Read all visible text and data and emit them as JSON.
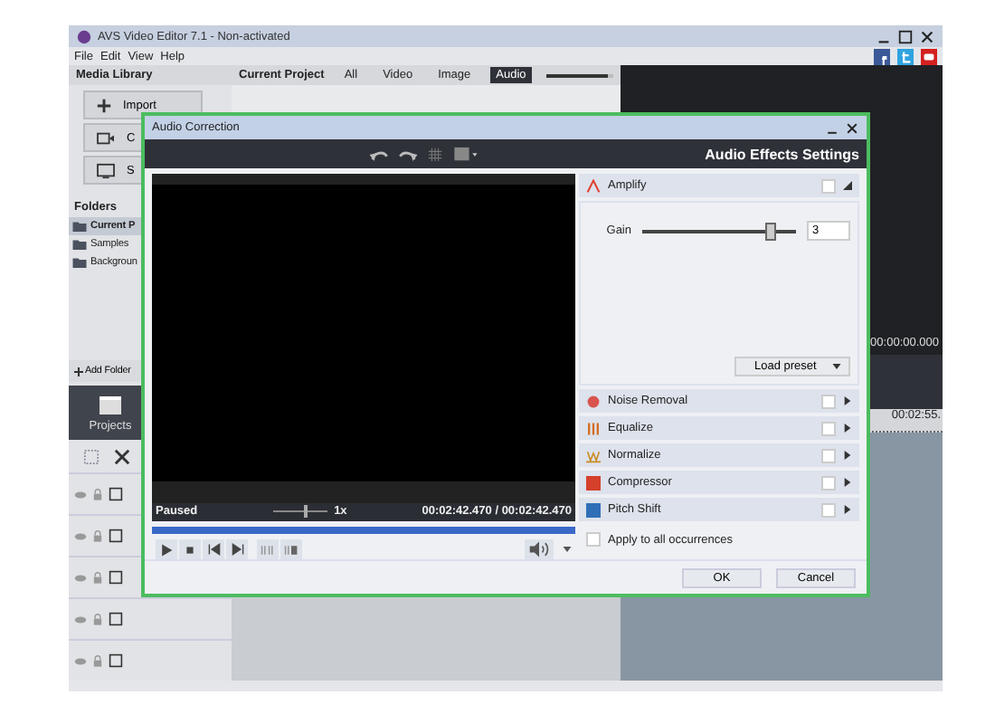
{
  "window": {
    "title": "AVS Video Editor 7.1 - Non-activated"
  },
  "menu": [
    "File",
    "Edit",
    "View",
    "Help"
  ],
  "media_library": {
    "title": "Media Library",
    "buttons": [
      "Import",
      "C",
      "S"
    ],
    "folders_title": "Folders",
    "folders": [
      {
        "label": "Current P",
        "selected": true
      },
      {
        "label": "Samples",
        "selected": false
      },
      {
        "label": "Backgroun",
        "selected": false
      }
    ],
    "add_folder": "Add Folder",
    "projects": "Projects"
  },
  "current_project": {
    "title": "Current Project",
    "tabs": [
      {
        "label": "All",
        "selected": false
      },
      {
        "label": "Video",
        "selected": false
      },
      {
        "label": "Image",
        "selected": false
      },
      {
        "label": "Audio",
        "selected": true
      }
    ],
    "zoom": {
      "level": 0.92
    }
  },
  "preview": {
    "time": "00:00:00.000",
    "ruler_time": "00:02:55."
  },
  "dialog": {
    "title": "Audio Correction",
    "panel_title": "Audio Effects Settings",
    "status": "Paused",
    "speed": {
      "level": 0.6
    },
    "speed_label": "1x",
    "time": "00:02:42.470 / 00:02:42.470",
    "progress": {
      "level": 1
    },
    "effects": [
      {
        "name": "Amplify",
        "kind": "amplify",
        "checked": false,
        "expanded": true,
        "gain_label": "Gain",
        "gain": {
          "level": 0.83
        },
        "gain_value": "3",
        "preset": "Load preset"
      },
      {
        "name": "Noise Removal",
        "kind": "noise",
        "checked": false,
        "expanded": false
      },
      {
        "name": "Equalize",
        "kind": "equalize",
        "checked": false,
        "expanded": false
      },
      {
        "name": "Normalize",
        "kind": "normalize",
        "checked": false,
        "expanded": false
      },
      {
        "name": "Compressor",
        "kind": "compressor",
        "checked": false,
        "expanded": false
      },
      {
        "name": "Pitch Shift",
        "kind": "pitch",
        "checked": false,
        "expanded": false
      }
    ],
    "apply_all": {
      "label": "Apply to all occurrences",
      "checked": false
    },
    "buttons": [
      "OK",
      "Cancel"
    ]
  }
}
